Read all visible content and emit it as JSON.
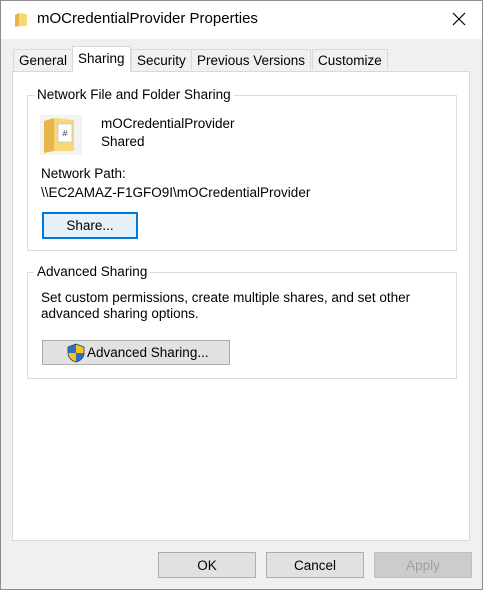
{
  "window": {
    "title": "mOCredentialProvider Properties",
    "close_icon": "close-icon",
    "folder_icon": "folder-icon"
  },
  "tabs": [
    {
      "label": "General"
    },
    {
      "label": "Sharing",
      "active": true
    },
    {
      "label": "Security"
    },
    {
      "label": "Previous Versions"
    },
    {
      "label": "Customize"
    }
  ],
  "network_sharing": {
    "group_title": "Network File and Folder Sharing",
    "folder_name": "mOCredentialProvider",
    "status": "Shared",
    "path_label": "Network Path:",
    "path_value": "\\\\EC2AMAZ-F1GFO9I\\mOCredentialProvider",
    "share_button": "Share..."
  },
  "advanced_sharing": {
    "group_title": "Advanced Sharing",
    "description_line1": "Set custom permissions, create multiple shares, and set other",
    "description_line2": "advanced sharing options.",
    "button": "Advanced Sharing...",
    "button_icon": "uac-shield-icon"
  },
  "footer": {
    "ok": "OK",
    "cancel": "Cancel",
    "apply": "Apply"
  },
  "colors": {
    "focus_border": "#0078d7",
    "dialog_bg": "#f0f0f0",
    "folder_yellow": "#f8d775"
  }
}
